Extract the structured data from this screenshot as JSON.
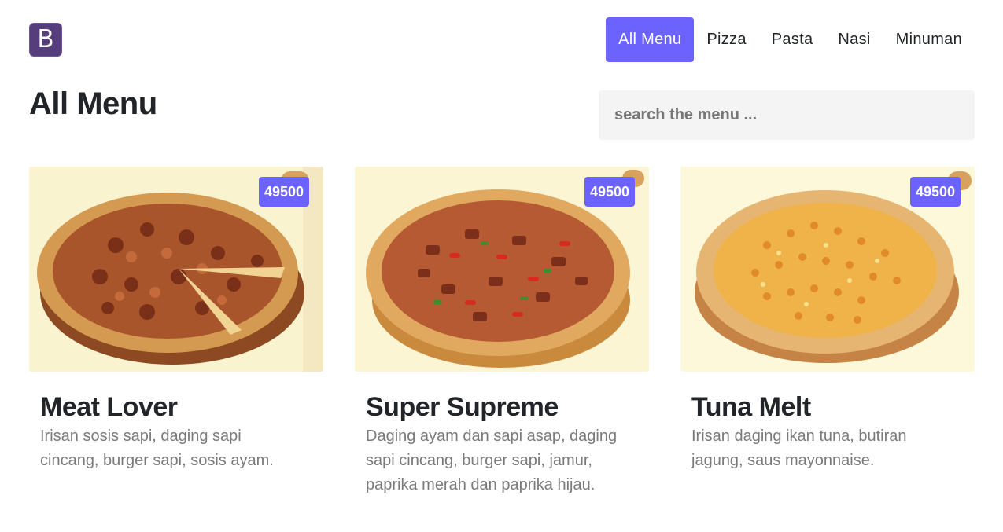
{
  "brand": {
    "logo_letter": "B"
  },
  "nav": {
    "items": [
      {
        "label": "All Menu",
        "active": true
      },
      {
        "label": "Pizza",
        "active": false
      },
      {
        "label": "Pasta",
        "active": false
      },
      {
        "label": "Nasi",
        "active": false
      },
      {
        "label": "Minuman",
        "active": false
      }
    ]
  },
  "main": {
    "title": "All Menu",
    "search_placeholder": "search the menu ..."
  },
  "menu_items": [
    {
      "name": "Meat Lover",
      "price": "49500",
      "description": "Irisan sosis sapi, daging sapi cincang, burger sapi, sosis ayam."
    },
    {
      "name": "Super Supreme",
      "price": "49500",
      "description": "Daging ayam dan sapi asap, daging sapi cincang, burger sapi, jamur, paprika merah dan paprika hijau."
    },
    {
      "name": "Tuna Melt",
      "price": "49500",
      "description": "Irisan daging ikan tuna, butiran jagung, saus mayonnaise."
    }
  ],
  "colors": {
    "accent": "#6c63ff",
    "brand": "#563d7c",
    "card_bg": "#fbf6d6"
  }
}
